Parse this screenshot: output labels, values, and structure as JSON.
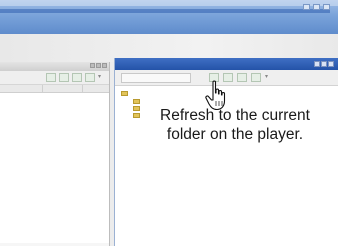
{
  "callout": {
    "line1": "Refresh to the current",
    "line2": "folder on the player."
  },
  "colors": {
    "header_blue": "#6d98d6",
    "player_title": "#2f5fb6",
    "folder": "#e2c45a"
  },
  "icons": [
    "hand-pointer-icon",
    "refresh-icon",
    "folder-icon",
    "window-minimize-icon",
    "window-maximize-icon",
    "window-close-icon"
  ]
}
